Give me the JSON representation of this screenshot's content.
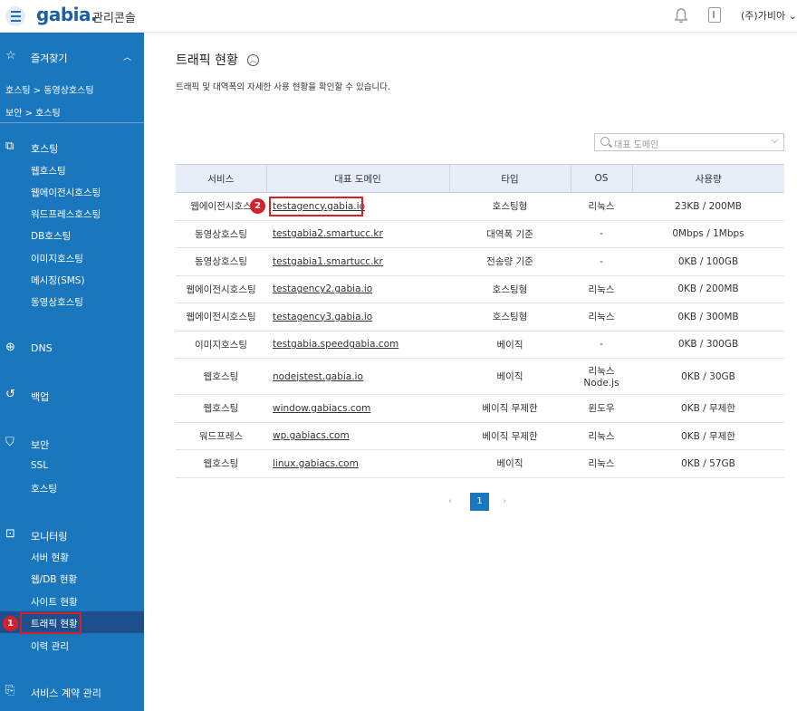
{
  "header": {
    "logo": "gabia.",
    "subtitle": "관리콘솔",
    "user": "(주)가비아"
  },
  "sidebar": {
    "favorites": "즐겨찾기",
    "favorite_links": [
      "호스팅 > 동영상호스팅",
      "보안 > 호스팅"
    ],
    "hosting": {
      "title": "호스팅",
      "items": [
        "웹호스팅",
        "웹에이전시호스팅",
        "워드프레스호스팅",
        "DB호스팅",
        "이미지호스팅",
        "메시징(SMS)",
        "동영상호스팅"
      ]
    },
    "dns": "DNS",
    "backup": "백업",
    "security": {
      "title": "보안",
      "items": [
        "SSL",
        "호스팅"
      ]
    },
    "monitoring": {
      "title": "모니터링",
      "items": [
        "서버 현황",
        "웹/DB 현황",
        "사이트 현황",
        "트래픽 현황",
        "이력 관리"
      ]
    },
    "contract": "서비스 계약 관리"
  },
  "annotations": {
    "badge1": "1",
    "badge2": "2"
  },
  "main": {
    "title": "트래픽 현황",
    "description": "트래픽 및 대역폭의 자세한 사용 현황을 확인할 수 있습니다.",
    "domain_filter_placeholder": "대표 도메인",
    "columns": [
      "서비스",
      "대표 도메인",
      "타입",
      "OS",
      "사용량"
    ],
    "rows": [
      {
        "service": "웹에이전시호스",
        "domain": "testagency.gabia.io",
        "type": "호스팅형",
        "os": "리눅스",
        "os2": "",
        "usage": "23KB / 200MB"
      },
      {
        "service": "동영상호스팅",
        "domain": "testgabia2.smartucc.kr",
        "type": "대역폭 기준",
        "os": "-",
        "os2": "",
        "usage": "0Mbps / 1Mbps"
      },
      {
        "service": "동영상호스팅",
        "domain": "testgabia1.smartucc.kr",
        "type": "전송량 기준",
        "os": "-",
        "os2": "",
        "usage": "0KB / 100GB"
      },
      {
        "service": "웹에이전시호스팅",
        "domain": "testagency2.gabia.io",
        "type": "호스팅형",
        "os": "리눅스",
        "os2": "",
        "usage": "0KB / 200MB"
      },
      {
        "service": "웹에이전시호스팅",
        "domain": "testagency3.gabia.io",
        "type": "호스팅형",
        "os": "리눅스",
        "os2": "",
        "usage": "0KB / 300MB"
      },
      {
        "service": "이미지호스팅",
        "domain": "testgabia.speedgabia.com",
        "type": "베이직",
        "os": "-",
        "os2": "",
        "usage": "0KB / 300GB"
      },
      {
        "service": "웹호스팅",
        "domain": "nodejstest.gabia.io",
        "type": "베이직",
        "os": "리눅스",
        "os2": "Node.js",
        "usage": "0KB / 30GB"
      },
      {
        "service": "웹호스팅",
        "domain": "window.gabiacs.com",
        "type": "베이직 무제한",
        "os": "윈도우",
        "os2": "",
        "usage": "0KB / 무제한"
      },
      {
        "service": "워드프레스",
        "domain": "wp.gabiacs.com",
        "type": "베이직 무제한",
        "os": "리눅스",
        "os2": "",
        "usage": "0KB / 무제한"
      },
      {
        "service": "웹호스팅",
        "domain": "linux.gabiacs.com",
        "type": "베이직",
        "os": "리눅스",
        "os2": "",
        "usage": "0KB / 57GB"
      }
    ],
    "pagination": {
      "prev": "‹",
      "current": "1",
      "next": "›"
    }
  }
}
